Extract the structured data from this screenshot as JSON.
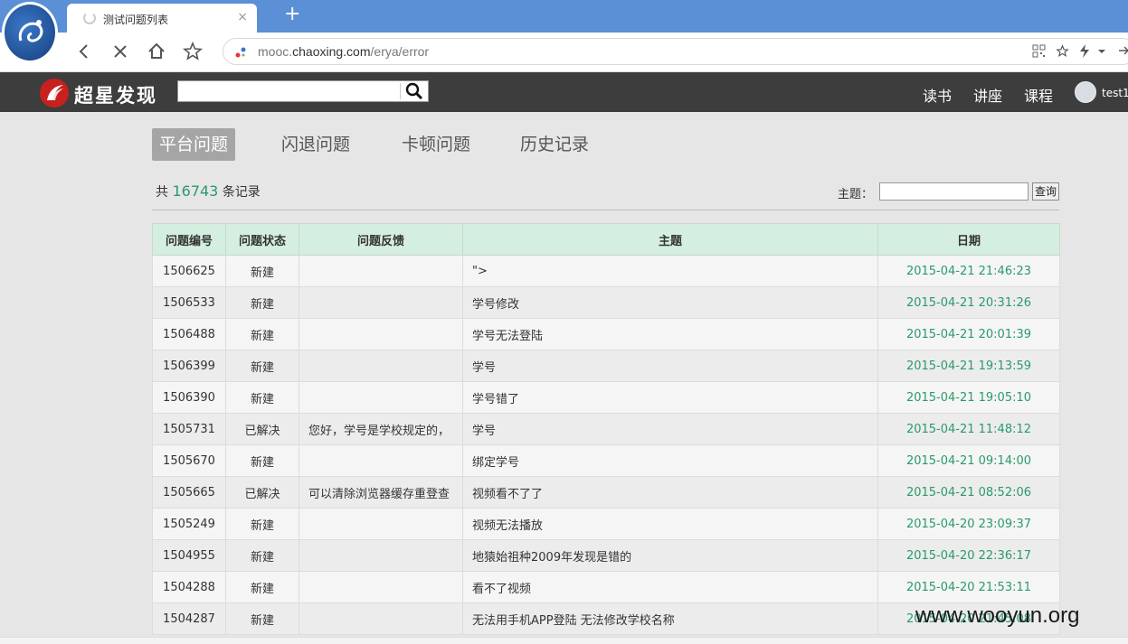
{
  "browser": {
    "tab_title": "测试问题列表",
    "tab_close": "×",
    "new_tab": "+",
    "url_prefix": "mooc.",
    "url_domain": "chaoxing.com",
    "url_path": "/erya/error"
  },
  "site": {
    "brand": "超星发现",
    "search_value": "",
    "nav": [
      "读书",
      "讲座",
      "课程"
    ],
    "username": "test1"
  },
  "tabs": [
    "平台问题",
    "闪退问题",
    "卡顿问题",
    "历史记录"
  ],
  "summary": {
    "prefix": "共",
    "count": "16743",
    "suffix": "条记录"
  },
  "filter": {
    "label": "主题：",
    "value": "",
    "button": "查询"
  },
  "table": {
    "headers": [
      "问题编号",
      "问题状态",
      "问题反馈",
      "主题",
      "日期"
    ],
    "rows": [
      {
        "id": "1506625",
        "status": "新建",
        "feedback": "",
        "topic": "\">",
        "date": "2015-04-21 21:46:23"
      },
      {
        "id": "1506533",
        "status": "新建",
        "feedback": "",
        "topic": "学号修改",
        "date": "2015-04-21 20:31:26"
      },
      {
        "id": "1506488",
        "status": "新建",
        "feedback": "",
        "topic": "学号无法登陆",
        "date": "2015-04-21 20:01:39"
      },
      {
        "id": "1506399",
        "status": "新建",
        "feedback": "",
        "topic": "学号",
        "date": "2015-04-21 19:13:59"
      },
      {
        "id": "1506390",
        "status": "新建",
        "feedback": "",
        "topic": "学号错了",
        "date": "2015-04-21 19:05:10"
      },
      {
        "id": "1505731",
        "status": "已解决",
        "feedback": "您好，学号是学校规定的，",
        "topic": "学号",
        "date": "2015-04-21 11:48:12"
      },
      {
        "id": "1505670",
        "status": "新建",
        "feedback": "",
        "topic": "绑定学号",
        "date": "2015-04-21 09:14:00"
      },
      {
        "id": "1505665",
        "status": "已解决",
        "feedback": "可以清除浏览器缓存重登查",
        "topic": "视频看不了了",
        "date": "2015-04-21 08:52:06"
      },
      {
        "id": "1505249",
        "status": "新建",
        "feedback": "",
        "topic": "视频无法播放",
        "date": "2015-04-20 23:09:37"
      },
      {
        "id": "1504955",
        "status": "新建",
        "feedback": "",
        "topic": "地猿始祖种2009年发现是错的",
        "date": "2015-04-20 22:36:17"
      },
      {
        "id": "1504288",
        "status": "新建",
        "feedback": "",
        "topic": "看不了视频",
        "date": "2015-04-20 21:53:11"
      },
      {
        "id": "1504287",
        "status": "新建",
        "feedback": "",
        "topic": "无法用手机APP登陆 无法修改学校名称",
        "date": "2015-04-20 21:45:08"
      }
    ]
  },
  "watermark": "www.wooyun.org"
}
